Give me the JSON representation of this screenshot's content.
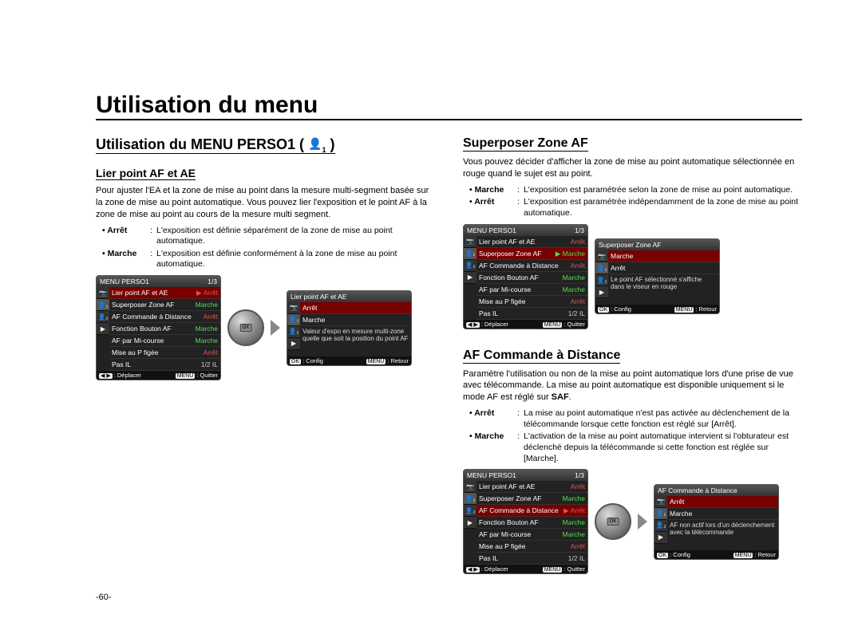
{
  "pageNumber": "-60-",
  "title": "Utilisation du menu",
  "sectionA": {
    "heading": "Utilisation du MENU PERSO1 (",
    "iconLabel": "1",
    "headingClose": ")",
    "sub1": {
      "title": "Lier point AF et AE",
      "body": "Pour ajuster l'EA et la zone de mise au point dans la mesure multi-segment basée sur la zone de mise au point automatique. Vous pouvez lier l'exposition et le point AF à la zone de mise au point au cours de la mesure multi segment.",
      "defs": [
        {
          "term": "Arrêt",
          "text": "L'exposition est définie séparément de la zone de mise au point automatique."
        },
        {
          "term": "Marche",
          "text": "L'exposition est définie conformément à la zone de mise au point automatique."
        }
      ],
      "menuA": {
        "title": "MENU PERSO1",
        "page": "1/3",
        "items": [
          {
            "label": "Lier point AF et AE",
            "value": "Arrêt",
            "sel": true,
            "cls": "off"
          },
          {
            "label": "Superposer Zone AF",
            "value": "Marche",
            "cls": "on"
          },
          {
            "label": "AF Commande à Distance",
            "value": "Arrêt",
            "cls": "off"
          },
          {
            "label": "Fonction Bouton AF",
            "value": "Marche",
            "cls": "on"
          },
          {
            "label": "AF par Mi-course",
            "value": "Marche",
            "cls": "on"
          },
          {
            "label": "Mise au P figée",
            "value": "Arrêt",
            "cls": "off"
          },
          {
            "label": "Pas IL",
            "value": "1/2 IL",
            "cls": "gray"
          }
        ],
        "footerLeft": "Déplacer",
        "footerRight": "Quitter"
      },
      "menuB": {
        "title": "Lier point AF et AE",
        "options": [
          {
            "label": "Arrêt",
            "sel": true
          },
          {
            "label": "Marche"
          }
        ],
        "help": "Valeur d'expo en mesure multi-zone quelle que soit la position du point AF",
        "footerLeft": "Config",
        "footerRight": "Retour"
      }
    }
  },
  "sectionB": {
    "sub1": {
      "title": "Superposer Zone AF",
      "body": "Vous pouvez décider d'afficher la zone de mise au point automatique sélectionnée en rouge quand le sujet est au point.",
      "defs": [
        {
          "term": "Marche",
          "text": "L'exposition est paramétrée selon la zone de mise au point automatique."
        },
        {
          "term": "Arrêt",
          "text": "L'exposition est paramétrée indépendamment de la zone de mise au point automatique."
        }
      ],
      "menuA": {
        "title": "MENU PERSO1",
        "page": "1/3",
        "items": [
          {
            "label": "Lier point AF et AE",
            "value": "Arrêt",
            "cls": "off"
          },
          {
            "label": "Superposer Zone AF",
            "value": "Marche",
            "sel": true,
            "cls": "on"
          },
          {
            "label": "AF Commande à Distance",
            "value": "Arrêt",
            "cls": "off"
          },
          {
            "label": "Fonction Bouton AF",
            "value": "Marche",
            "cls": "on"
          },
          {
            "label": "AF par Mi-course",
            "value": "Marche",
            "cls": "on"
          },
          {
            "label": "Mise au P figée",
            "value": "Arrêt",
            "cls": "off"
          },
          {
            "label": "Pas IL",
            "value": "1/2 IL",
            "cls": "gray"
          }
        ],
        "footerLeft": "Déplacer",
        "footerRight": "Quitter"
      },
      "menuB": {
        "title": "Superposer Zone AF",
        "options": [
          {
            "label": "Marche",
            "sel": true
          },
          {
            "label": "Arrêt"
          }
        ],
        "help": "Le point AF sélectionné s'affiche dans le viseur en rouge",
        "footerLeft": "Config",
        "footerRight": "Retour"
      }
    },
    "sub2": {
      "title": "AF Commande à Distance",
      "body1": "Paramètre l'utilisation ou non de la mise au point automatique lors d'une prise de vue avec télécommande. La mise au point automatique est disponible uniquement si le mode AF est réglé sur ",
      "bodyBold": "SAF",
      "body2": ".",
      "defs": [
        {
          "term": "Arrêt",
          "text": "La mise au point automatique n'est pas activée au déclenchement de la télécommande lorsque cette fonction est réglé sur [Arrêt]."
        },
        {
          "term": "Marche",
          "text": "L'activation de la mise au point automatique intervient si l'obturateur est déclenché depuis la télécommande si cette fonction est réglée sur [Marche]."
        }
      ],
      "menuA": {
        "title": "MENU PERSO1",
        "page": "1/3",
        "items": [
          {
            "label": "Lier point AF et AE",
            "value": "Arrêt",
            "cls": "off"
          },
          {
            "label": "Superposer Zone AF",
            "value": "Marche",
            "cls": "on"
          },
          {
            "label": "AF Commande à Distance",
            "value": "Arrêt",
            "sel": true,
            "cls": "off"
          },
          {
            "label": "Fonction Bouton AF",
            "value": "Marche",
            "cls": "on"
          },
          {
            "label": "AF par Mi-course",
            "value": "Marche",
            "cls": "on"
          },
          {
            "label": "Mise au P figée",
            "value": "Arrêt",
            "cls": "off"
          },
          {
            "label": "Pas IL",
            "value": "1/2 IL",
            "cls": "gray"
          }
        ],
        "footerLeft": "Déplacer",
        "footerRight": "Quitter"
      },
      "menuB": {
        "title": "AF Commande à Distance",
        "options": [
          {
            "label": "Arrêt",
            "sel": true
          },
          {
            "label": "Marche"
          }
        ],
        "help": "AF non actif lors d'un déclenchement avec la télécommande",
        "footerLeft": "Config",
        "footerRight": "Retour"
      }
    }
  },
  "btnLabels": {
    "ok": "OK",
    "menu": "MENU",
    "dpad": "◀ ▶"
  }
}
